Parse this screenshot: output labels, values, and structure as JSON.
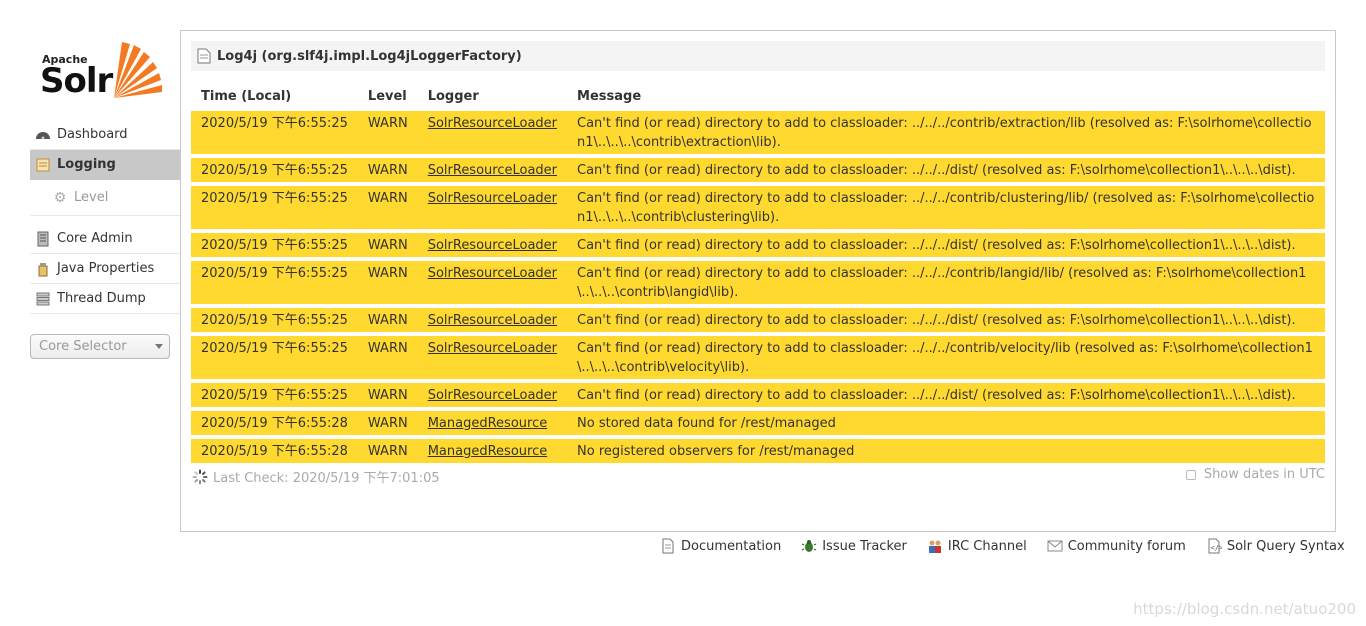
{
  "logo": {
    "apache": "Apache",
    "solr": "Solr"
  },
  "menu": {
    "items": [
      {
        "label": "Dashboard",
        "icon": "dashboard-icon"
      },
      {
        "label": "Logging",
        "icon": "logging-icon",
        "active": true
      },
      {
        "label": "Level",
        "icon": "gear-icon",
        "sub": true
      },
      {
        "label": "Core Admin",
        "icon": "core-admin-icon"
      },
      {
        "label": "Java Properties",
        "icon": "java-icon"
      },
      {
        "label": "Thread Dump",
        "icon": "thread-dump-icon"
      }
    ]
  },
  "core_selector": {
    "placeholder": "Core Selector"
  },
  "panel": {
    "title": "Log4j (org.slf4j.impl.Log4jLoggerFactory)",
    "columns": [
      "Time (Local)",
      "Level",
      "Logger",
      "Message"
    ],
    "rows": [
      {
        "time": "2020/5/19 下午6:55:25",
        "level": "WARN",
        "logger": "SolrResourceLoader",
        "message": "Can't find (or read) directory to add to classloader: ../../../contrib/extraction/lib (resolved as: F:\\solrhome\\collection1\\..\\..\\..\\contrib\\extraction\\lib)."
      },
      {
        "time": "2020/5/19 下午6:55:25",
        "level": "WARN",
        "logger": "SolrResourceLoader",
        "message": "Can't find (or read) directory to add to classloader: ../../../dist/ (resolved as: F:\\solrhome\\collection1\\..\\..\\..\\dist)."
      },
      {
        "time": "2020/5/19 下午6:55:25",
        "level": "WARN",
        "logger": "SolrResourceLoader",
        "message": "Can't find (or read) directory to add to classloader: ../../../contrib/clustering/lib/ (resolved as: F:\\solrhome\\collection1\\..\\..\\..\\contrib\\clustering\\lib)."
      },
      {
        "time": "2020/5/19 下午6:55:25",
        "level": "WARN",
        "logger": "SolrResourceLoader",
        "message": "Can't find (or read) directory to add to classloader: ../../../dist/ (resolved as: F:\\solrhome\\collection1\\..\\..\\..\\dist)."
      },
      {
        "time": "2020/5/19 下午6:55:25",
        "level": "WARN",
        "logger": "SolrResourceLoader",
        "message": "Can't find (or read) directory to add to classloader: ../../../contrib/langid/lib/ (resolved as: F:\\solrhome\\collection1\\..\\..\\..\\contrib\\langid\\lib)."
      },
      {
        "time": "2020/5/19 下午6:55:25",
        "level": "WARN",
        "logger": "SolrResourceLoader",
        "message": "Can't find (or read) directory to add to classloader: ../../../dist/ (resolved as: F:\\solrhome\\collection1\\..\\..\\..\\dist)."
      },
      {
        "time": "2020/5/19 下午6:55:25",
        "level": "WARN",
        "logger": "SolrResourceLoader",
        "message": "Can't find (or read) directory to add to classloader: ../../../contrib/velocity/lib (resolved as: F:\\solrhome\\collection1\\..\\..\\..\\contrib\\velocity\\lib)."
      },
      {
        "time": "2020/5/19 下午6:55:25",
        "level": "WARN",
        "logger": "SolrResourceLoader",
        "message": "Can't find (or read) directory to add to classloader: ../../../dist/ (resolved as: F:\\solrhome\\collection1\\..\\..\\..\\dist)."
      },
      {
        "time": "2020/5/19 下午6:55:28",
        "level": "WARN",
        "logger": "ManagedResource",
        "message": "No stored data found for /rest/managed"
      },
      {
        "time": "2020/5/19 下午6:55:28",
        "level": "WARN",
        "logger": "ManagedResource",
        "message": "No registered observers for /rest/managed"
      }
    ],
    "last_check": "Last Check: 2020/5/19 下午7:01:05",
    "utc_label": "Show dates in UTC"
  },
  "footer": [
    {
      "label": "Documentation",
      "icon": "document-icon"
    },
    {
      "label": "Issue Tracker",
      "icon": "bug-icon"
    },
    {
      "label": "IRC Channel",
      "icon": "people-icon"
    },
    {
      "label": "Community forum",
      "icon": "mail-icon"
    },
    {
      "label": "Solr Query Syntax",
      "icon": "query-syntax-icon"
    }
  ],
  "watermark": "https://blog.csdn.net/atuo200",
  "colors": {
    "warn_row": "#ffd92f",
    "active_menu": "#c8c8c8",
    "logo_orange": "#f47920"
  }
}
